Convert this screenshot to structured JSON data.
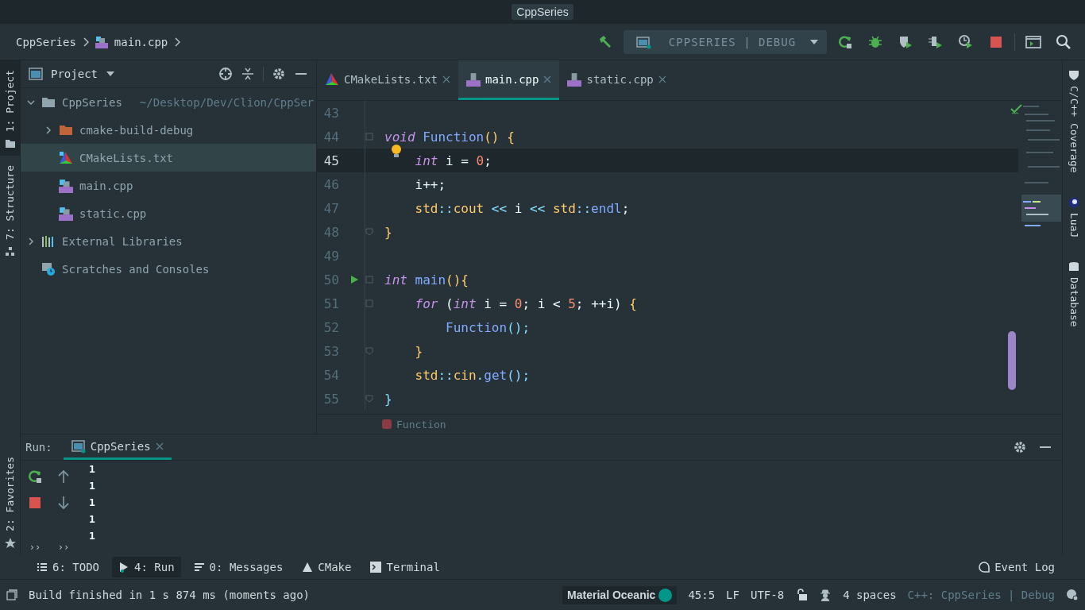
{
  "title_bar": {
    "title": "CppSeries"
  },
  "nav_bar": {
    "breadcrumbs": [
      "CppSeries",
      "main.cpp"
    ],
    "run_config": "CPPSERIES | DEBUG"
  },
  "left_stripe": [
    {
      "label": "1: Project",
      "kind": "folder",
      "selected": true
    },
    {
      "label": "7: Structure",
      "kind": "structure",
      "selected": false
    }
  ],
  "favorites": {
    "label": "2: Favorites",
    "selected": false
  },
  "project": {
    "title": "Project",
    "tree": [
      {
        "label": "CppSeries",
        "path": "~/Desktop/Dev/Clion/CppSer",
        "kind": "folder",
        "expanded": true,
        "selected": false,
        "children": [
          {
            "label": "cmake-build-debug",
            "kind": "build",
            "expanded": false,
            "selected": false
          },
          {
            "label": "CMakeLists.txt",
            "kind": "cmake",
            "selected": true
          },
          {
            "label": "main.cpp",
            "kind": "cpp",
            "selected": false
          },
          {
            "label": "static.cpp",
            "kind": "cpp",
            "selected": false
          }
        ]
      },
      {
        "label": "External Libraries",
        "kind": "library",
        "expanded": false,
        "selected": false
      },
      {
        "label": "Scratches and Consoles",
        "kind": "scratches",
        "selected": false
      }
    ]
  },
  "editor": {
    "tabs": [
      {
        "label": "CMakeLists.txt",
        "kind": "cmake",
        "selected": false
      },
      {
        "label": "main.cpp",
        "kind": "cpp",
        "selected": true
      },
      {
        "label": "static.cpp",
        "kind": "cpp",
        "selected": false
      }
    ],
    "lines": [
      {
        "number": "43",
        "current": false,
        "kind": "plain"
      },
      {
        "number": "44",
        "current": false,
        "kind": "fold_start",
        "tokens": [
          {
            "text": "void",
            "kind": "kw"
          },
          {
            "text": " Function",
            "kind": "fn"
          },
          {
            "text": "() {",
            "kind": "br"
          }
        ]
      },
      {
        "number": "45",
        "current": true,
        "kind": "bulb",
        "tokens": [
          {
            "text": "    int",
            "kind": "kw"
          },
          {
            "text": " i = ",
            "kind": "p"
          },
          {
            "text": "0",
            "kind": "num"
          },
          {
            "text": ";",
            "kind": "p"
          }
        ]
      },
      {
        "number": "46",
        "current": false,
        "kind": "plain",
        "tokens": [
          {
            "text": "    i++;",
            "kind": "p"
          }
        ]
      },
      {
        "number": "47",
        "current": false,
        "kind": "plain",
        "tokens": [
          {
            "text": "    std",
            "kind": "ns"
          },
          {
            "text": "::",
            "kind": "pa"
          },
          {
            "text": "cout",
            "kind": "ns"
          },
          {
            "text": " << ",
            "kind": "pa"
          },
          {
            "text": "i",
            "kind": "p"
          },
          {
            "text": " << ",
            "kind": "pa"
          },
          {
            "text": "std",
            "kind": "ns"
          },
          {
            "text": "::",
            "kind": "pa"
          },
          {
            "text": "endl",
            "kind": "fn"
          },
          {
            "text": ";",
            "kind": "p"
          }
        ]
      },
      {
        "number": "48",
        "current": false,
        "kind": "fold_end",
        "tokens": [
          {
            "text": "}",
            "kind": "br"
          }
        ]
      },
      {
        "number": "49",
        "current": false,
        "kind": "plain"
      },
      {
        "number": "50",
        "current": false,
        "kind": "run",
        "tokens": [
          {
            "text": "int",
            "kind": "kw"
          },
          {
            "text": " main",
            "kind": "fn"
          },
          {
            "text": "(){",
            "kind": "br"
          }
        ]
      },
      {
        "number": "51",
        "current": false,
        "kind": "fold_start",
        "tokens": [
          {
            "text": "    for",
            "kind": "kw"
          },
          {
            "text": " (",
            "kind": "p"
          },
          {
            "text": "int",
            "kind": "kw"
          },
          {
            "text": " i = ",
            "kind": "p"
          },
          {
            "text": "0",
            "kind": "num"
          },
          {
            "text": "; i < ",
            "kind": "p"
          },
          {
            "text": "5",
            "kind": "num"
          },
          {
            "text": "; ++i) ",
            "kind": "p"
          },
          {
            "text": "{",
            "kind": "br"
          }
        ]
      },
      {
        "number": "52",
        "current": false,
        "kind": "plain",
        "tokens": [
          {
            "text": "        Function",
            "kind": "fn"
          },
          {
            "text": "();",
            "kind": "pa"
          }
        ]
      },
      {
        "number": "53",
        "current": false,
        "kind": "fold_end",
        "tokens": [
          {
            "text": "    }",
            "kind": "br"
          }
        ]
      },
      {
        "number": "54",
        "current": false,
        "kind": "plain",
        "tokens": [
          {
            "text": "    std",
            "kind": "ns"
          },
          {
            "text": "::",
            "kind": "pa"
          },
          {
            "text": "cin",
            "kind": "ns"
          },
          {
            "text": ".",
            "kind": "pa"
          },
          {
            "text": "get",
            "kind": "fn"
          },
          {
            "text": "();",
            "kind": "pa"
          }
        ]
      },
      {
        "number": "55",
        "current": false,
        "kind": "fold_end",
        "tokens": [
          {
            "text": "}",
            "kind": "pa"
          }
        ]
      }
    ],
    "breadcrumb": "Function"
  },
  "right_stripe": [
    {
      "label": "C/C++ Coverage",
      "kind": "shield"
    },
    {
      "label": "LuaJ",
      "kind": "moon"
    },
    {
      "label": "Database",
      "kind": "database"
    }
  ],
  "run": {
    "label": "Run:",
    "tabs": [
      {
        "label": "CppSeries",
        "selected": true
      }
    ],
    "output": [
      "1",
      "1",
      "1",
      "1",
      "1"
    ],
    "more": [
      "››",
      "››"
    ]
  },
  "tool_windows": [
    {
      "label": "6: TODO",
      "kind": "list",
      "selected": false
    },
    {
      "label": "4: Run",
      "kind": "run",
      "selected": true
    },
    {
      "label": "0: Messages",
      "kind": "messages",
      "selected": false
    },
    {
      "label": "CMake",
      "kind": "triangle",
      "selected": false
    },
    {
      "label": "Terminal",
      "kind": "terminal",
      "selected": false
    }
  ],
  "event_log": "Event Log",
  "status_bar": {
    "message": "Build finished in 1 s 874 ms (moments ago)",
    "theme": "Material Oceanic",
    "position": "45:5",
    "line_separator": "LF",
    "encoding": "UTF-8",
    "indent": "4 spaces",
    "context": "C++: CppSeries | Debug"
  }
}
